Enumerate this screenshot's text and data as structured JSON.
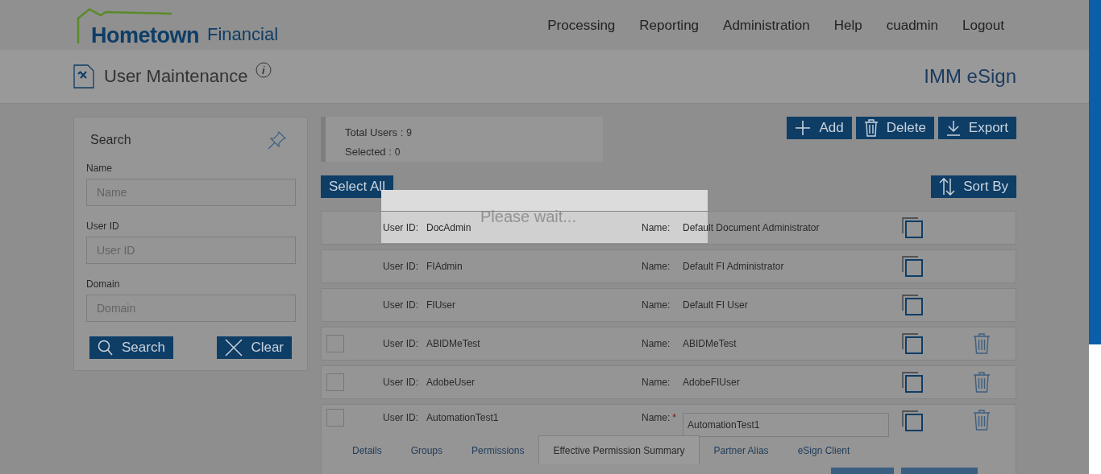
{
  "header": {
    "logo": {
      "brand": "Hometown",
      "suffix": "Financial"
    },
    "nav": [
      "Processing",
      "Reporting",
      "Administration",
      "Help",
      "cuadmin",
      "Logout"
    ]
  },
  "page_header": {
    "title": "User Maintenance",
    "product": "IMM eSign"
  },
  "search_panel": {
    "title": "Search",
    "fields": [
      {
        "label": "Name",
        "placeholder": "Name"
      },
      {
        "label": "User ID",
        "placeholder": "User ID"
      },
      {
        "label": "Domain",
        "placeholder": "Domain"
      }
    ],
    "buttons": [
      {
        "kind": "search",
        "label": "Search"
      },
      {
        "kind": "clear",
        "label": "Clear"
      }
    ]
  },
  "summary": {
    "total_label": "Total Users :",
    "total": "9",
    "selected_label": "Selected :",
    "selected": "0"
  },
  "actions": [
    {
      "kind": "add",
      "label": "Add"
    },
    {
      "kind": "delete",
      "label": "Delete"
    },
    {
      "kind": "export",
      "label": "Export"
    }
  ],
  "select_all": "Select All",
  "sort": "Sort By",
  "users": [
    {
      "id_label": "User ID:",
      "id": "DocAdmin",
      "name_label": "Name:",
      "name": "Default Document Administrator",
      "selectable": false,
      "deletable": false,
      "editing": false
    },
    {
      "id_label": "User ID:",
      "id": "FIAdmin",
      "name_label": "Name:",
      "name": "Default FI Administrator",
      "selectable": false,
      "deletable": false,
      "editing": false
    },
    {
      "id_label": "User ID:",
      "id": "FIUser",
      "name_label": "Name:",
      "name": "Default FI User",
      "selectable": false,
      "deletable": false,
      "editing": false
    },
    {
      "id_label": "User ID:",
      "id": "ABIDMeTest",
      "name_label": "Name:",
      "name": "ABIDMeTest",
      "selectable": true,
      "checked": false,
      "deletable": true,
      "editing": false
    },
    {
      "id_label": "User ID:",
      "id": "AdobeUser",
      "name_label": "Name:",
      "name": "AdobeFIUser",
      "selectable": true,
      "checked": false,
      "deletable": true,
      "editing": false
    },
    {
      "id_label": "User ID:",
      "id": "AutomationTest1",
      "name_label": "Name:",
      "name": "AutomationTest1",
      "selectable": true,
      "checked": false,
      "deletable": true,
      "editing": true,
      "required_mark": "*",
      "tabs": [
        {
          "label": "Details",
          "selected": false
        },
        {
          "label": "Groups",
          "selected": false
        },
        {
          "label": "Permissions",
          "selected": false
        },
        {
          "label": "Effective Permission Summary",
          "selected": true
        },
        {
          "label": "Partner Alias",
          "selected": false
        },
        {
          "label": "eSign Client",
          "selected": false
        }
      ]
    }
  ],
  "overlay": {
    "message": "Please wait..."
  }
}
